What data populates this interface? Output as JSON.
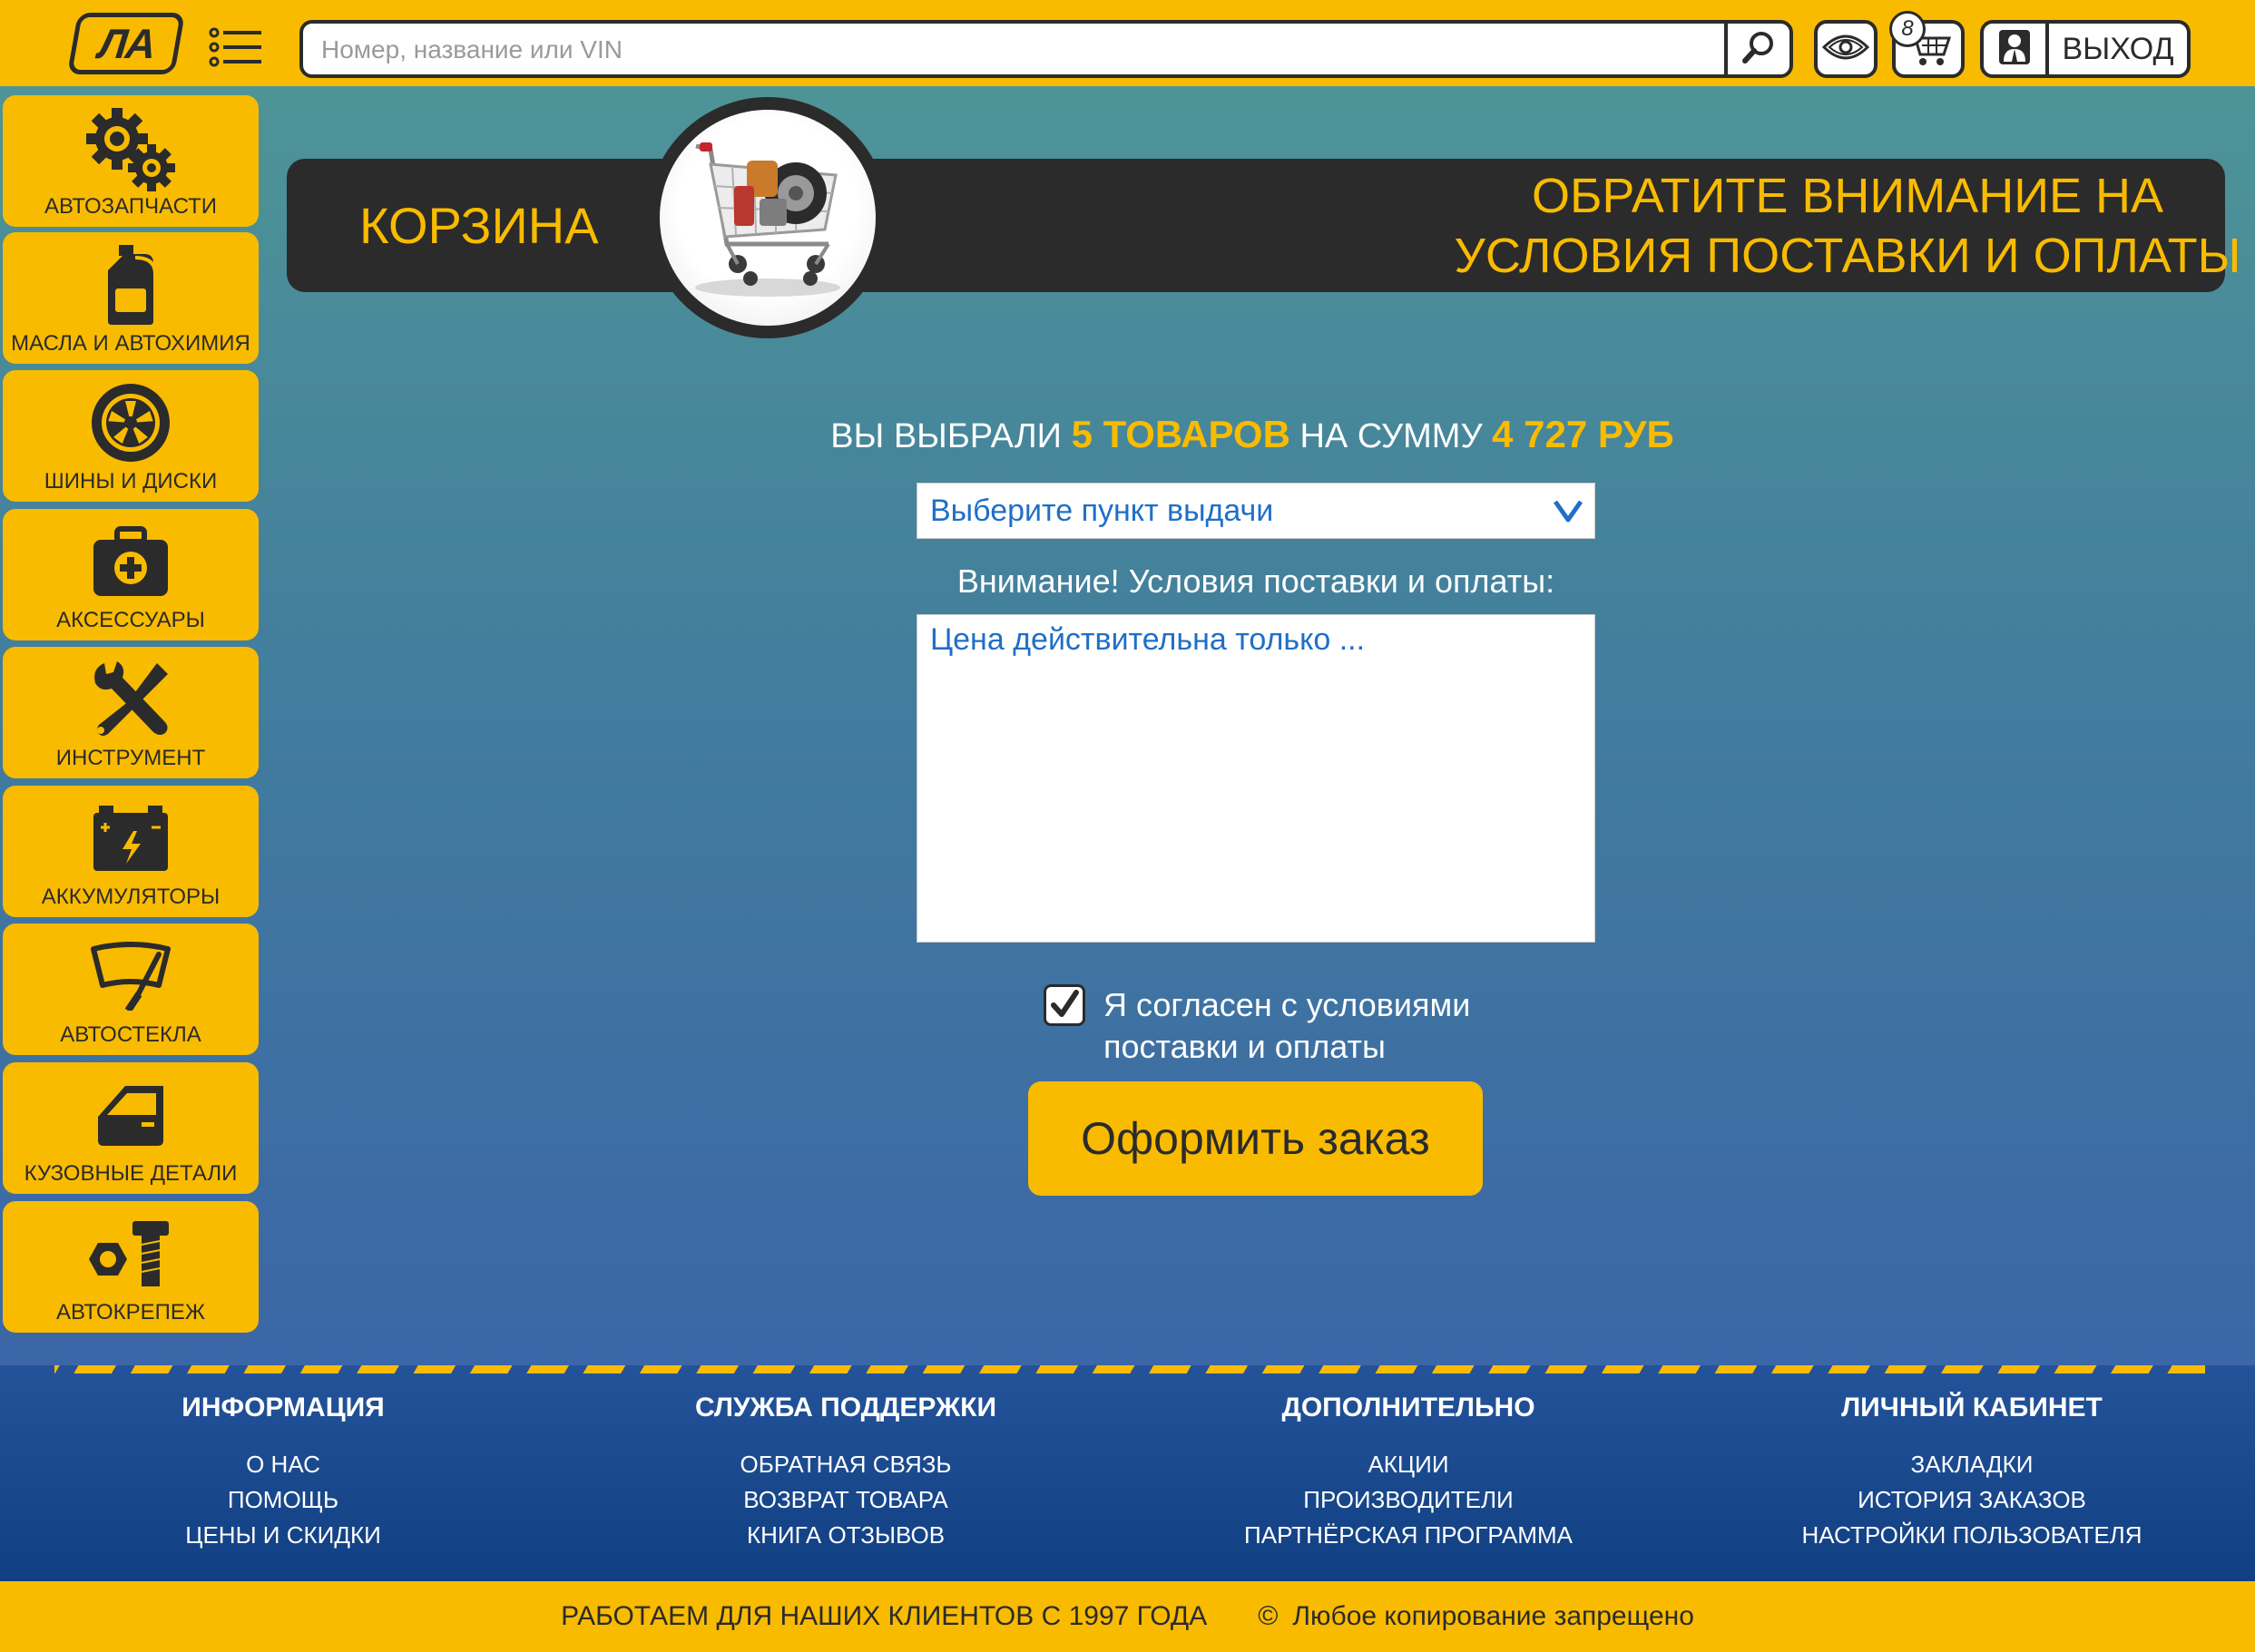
{
  "header": {
    "logo_text": "ЛА",
    "search_placeholder": "Номер, название или VIN",
    "cart_count": "8",
    "exit_label": "ВЫХОД"
  },
  "sidebar": {
    "items": [
      {
        "label": "АВТОЗАПЧАСТИ",
        "icon": "gears-icon"
      },
      {
        "label": "МАСЛА И АВТОХИМИЯ",
        "icon": "oil-canister-icon"
      },
      {
        "label": "ШИНЫ И ДИСКИ",
        "icon": "wheel-icon"
      },
      {
        "label": "АКСЕССУАРЫ",
        "icon": "first-aid-kit-icon"
      },
      {
        "label": "ИНСТРУМЕНТ",
        "icon": "tools-icon"
      },
      {
        "label": "АККУМУЛЯТОРЫ",
        "icon": "battery-icon"
      },
      {
        "label": "АВТОСТЕКЛА",
        "icon": "windshield-icon"
      },
      {
        "label": "КУЗОВНЫЕ ДЕТАЛИ",
        "icon": "car-door-icon"
      },
      {
        "label": "АВТОКРЕПЕЖ",
        "icon": "bolt-nut-icon"
      }
    ]
  },
  "banner": {
    "title": "КОРЗИНА",
    "note_line1": "ОБРАТИТЕ ВНИМАНИЕ НА",
    "note_line2": "УСЛОВИЯ ПОСТАВКИ И ОПЛАТЫ"
  },
  "cart": {
    "summary_prefix": "ВЫ ВЫБРАЛИ",
    "items_count": "5 ТОВАРОВ",
    "summary_middle": "НА СУММУ",
    "total": "4 727 РУБ",
    "pickup_select": "Выберите пункт выдачи",
    "terms_label": "Внимание! Условия поставки и оплаты:",
    "terms_text": "Цена действительна только ...",
    "agree_line1": "Я согласен с условиями",
    "agree_line2": "поставки и оплаты",
    "agree_checked": true,
    "order_button": "Оформить заказ"
  },
  "footer": {
    "columns": [
      {
        "title": "ИНФОРМАЦИЯ",
        "links": [
          "О НАС",
          "ПОМОЩЬ",
          "ЦЕНЫ И СКИДКИ"
        ]
      },
      {
        "title": "СЛУЖБА ПОДДЕРЖКИ",
        "links": [
          "ОБРАТНАЯ СВЯЗЬ",
          "ВОЗВРАТ ТОВАРА",
          "КНИГА ОТЗЫВОВ"
        ]
      },
      {
        "title": "ДОПОЛНИТЕЛЬНО",
        "links": [
          "АКЦИИ",
          "ПРОИЗВОДИТЕЛИ",
          "ПАРТНЁРСКАЯ ПРОГРАММА"
        ]
      },
      {
        "title": "ЛИЧНЫЙ КАБИНЕТ",
        "links": [
          "ЗАКЛАДКИ",
          "ИСТОРИЯ ЗАКАЗОВ",
          "НАСТРОЙКИ ПОЛЬЗОВАТЕЛЯ"
        ]
      }
    ],
    "slogan": "РАБОТАЕМ ДЛЯ НАШИХ КЛИЕНТОВ С 1997 ГОДА",
    "copyright_symbol": "©",
    "copyright": "Любое копирование запрещено"
  },
  "colors": {
    "accent": "#f9bb00",
    "dark": "#2b2b2b",
    "link_blue": "#1f6fc7",
    "footer_blue": "#103f82"
  }
}
